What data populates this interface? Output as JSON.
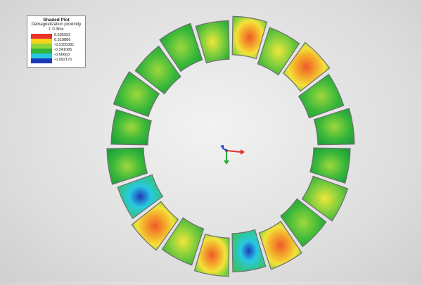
{
  "legend": {
    "title": "Shaded Plot",
    "subtitle": "Demagnetization proximity",
    "time": "t: 0.3ms",
    "entries": [
      {
        "color": "#e8322a",
        "value": "0.635552"
      },
      {
        "color": "#f7d21a",
        "value": "0.318886"
      },
      {
        "color": "#8cd43a",
        "value": "-0.0155391"
      },
      {
        "color": "#2fb33a",
        "value": "-0.341085"
      },
      {
        "color": "#27c9e2",
        "value": "-0.66663"
      },
      {
        "color": "#1e39b8",
        "value": "-0.992176"
      }
    ]
  },
  "viewport": {
    "background": "#e2e2e2",
    "axis_triad": {
      "x_color": "#e03030",
      "y_color": "#2aa63a",
      "z_color": "#2244cc"
    }
  },
  "model": {
    "description_icon": "ring-magnet-segments",
    "segment_count": 20
  }
}
